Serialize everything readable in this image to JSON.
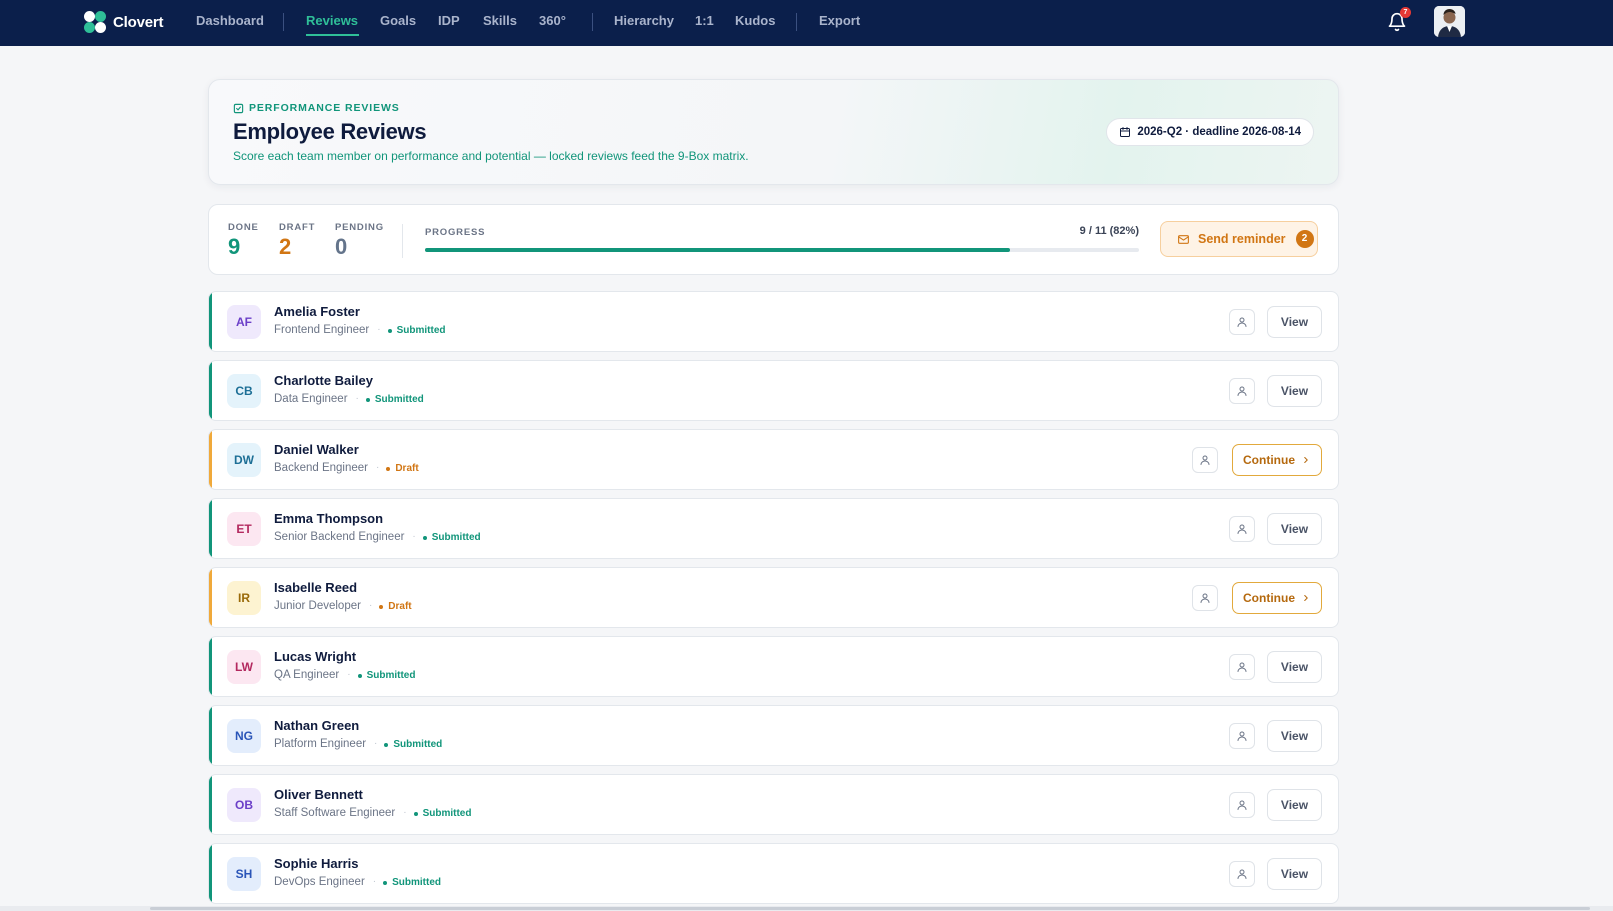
{
  "app": {
    "name": "Clovert"
  },
  "nav": [
    {
      "label": "Dashboard",
      "active": false
    },
    {
      "label": "Reviews",
      "active": true
    },
    {
      "label": "Goals",
      "active": false
    },
    {
      "label": "IDP",
      "active": false
    },
    {
      "label": "Skills",
      "active": false
    },
    {
      "label": "360°",
      "active": false
    },
    {
      "label": "Hierarchy",
      "active": false
    },
    {
      "label": "1:1",
      "active": false
    },
    {
      "label": "Kudos",
      "active": false
    },
    {
      "label": "Export",
      "active": false
    }
  ],
  "notifications": {
    "count": "7",
    "icon": "bell-icon"
  },
  "header": {
    "eyebrow": "PERFORMANCE REVIEWS",
    "title": "Employee Reviews",
    "subtitle": "Score each team member on performance and potential — locked reviews feed the 9-Box matrix.",
    "period": "2026-Q2 · deadline 2026-08-14"
  },
  "stats": {
    "done_label": "DONE",
    "done_value": "9",
    "draft_label": "DRAFT",
    "draft_value": "2",
    "pending_label": "PENDING",
    "pending_value": "0",
    "progress_label": "PROGRESS",
    "progress_text": "9 / 11 (82%)",
    "progress_fraction": 0.82,
    "reminder_label": "Send reminder",
    "reminder_count": "2"
  },
  "colors": {
    "nav_bg": "#0b1f4b",
    "accent": "#11957a",
    "draft": "#d17614",
    "pending": "#64748b"
  },
  "reviews": [
    {
      "initials": "AF",
      "name": "Amelia Foster",
      "role": "Frontend Engineer",
      "status": "Submitted",
      "state": "submitted",
      "action": "View",
      "bg": "#efe9fc",
      "fg": "#6b3fc8"
    },
    {
      "initials": "CB",
      "name": "Charlotte Bailey",
      "role": "Data Engineer",
      "status": "Submitted",
      "state": "submitted",
      "action": "View",
      "bg": "#e4f3fb",
      "fg": "#1d6f96"
    },
    {
      "initials": "DW",
      "name": "Daniel Walker",
      "role": "Backend Engineer",
      "status": "Draft",
      "state": "draft",
      "action": "Continue",
      "bg": "#e4f3fb",
      "fg": "#1d6f96"
    },
    {
      "initials": "ET",
      "name": "Emma Thompson",
      "role": "Senior Backend Engineer",
      "status": "Submitted",
      "state": "submitted",
      "action": "View",
      "bg": "#fce7f1",
      "fg": "#b3295f"
    },
    {
      "initials": "IR",
      "name": "Isabelle Reed",
      "role": "Junior Developer",
      "status": "Draft",
      "state": "draft",
      "action": "Continue",
      "bg": "#fdf3d1",
      "fg": "#9a6a08"
    },
    {
      "initials": "LW",
      "name": "Lucas Wright",
      "role": "QA Engineer",
      "status": "Submitted",
      "state": "submitted",
      "action": "View",
      "bg": "#fce7f1",
      "fg": "#b3295f"
    },
    {
      "initials": "NG",
      "name": "Nathan Green",
      "role": "Platform Engineer",
      "status": "Submitted",
      "state": "submitted",
      "action": "View",
      "bg": "#e3edfc",
      "fg": "#2a55b8"
    },
    {
      "initials": "OB",
      "name": "Oliver Bennett",
      "role": "Staff Software Engineer",
      "status": "Submitted",
      "state": "submitted",
      "action": "View",
      "bg": "#efe9fc",
      "fg": "#6b3fc8"
    },
    {
      "initials": "SH",
      "name": "Sophie Harris",
      "role": "DevOps Engineer",
      "status": "Submitted",
      "state": "submitted",
      "action": "View",
      "bg": "#e3edfc",
      "fg": "#2a55b8"
    }
  ]
}
